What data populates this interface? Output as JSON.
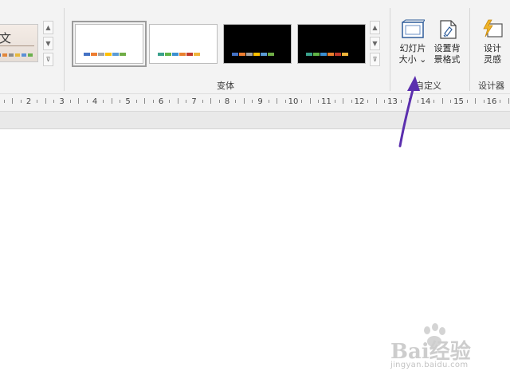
{
  "ribbon": {
    "themes": {
      "partial_glyph": "文",
      "partial_colors": [
        "#4a73b8",
        "#e2863a",
        "#8c8c8c",
        "#e6b83b",
        "#5b8fd6",
        "#6ab04c"
      ]
    },
    "variants": {
      "group_label": "变体",
      "items": [
        {
          "name": "variant-white-1",
          "bg": "#ffffff",
          "swatches": [
            "#4472c4",
            "#ed7d31",
            "#a5a5a5",
            "#ffc000",
            "#5b9bd5",
            "#70ad47"
          ]
        },
        {
          "name": "variant-white-2",
          "bg": "#ffffff",
          "swatches": [
            "#3aa18c",
            "#5fb346",
            "#3b8fd0",
            "#e8802e",
            "#c0392b",
            "#f0b53a"
          ]
        },
        {
          "name": "variant-black-1",
          "bg": "#000000",
          "swatches": [
            "#4472c4",
            "#ed7d31",
            "#a5a5a5",
            "#ffc000",
            "#5b9bd5",
            "#70ad47"
          ]
        },
        {
          "name": "variant-black-2",
          "bg": "#000000",
          "swatches": [
            "#3aa18c",
            "#5fb346",
            "#3b8fd0",
            "#e8802e",
            "#c0392b",
            "#f0b53a"
          ]
        }
      ]
    },
    "customize": {
      "group_label": "自定义",
      "slide_size": {
        "line1": "幻灯片",
        "line2": "大小",
        "chevron": "⌄"
      },
      "format_background": {
        "line1": "设置背",
        "line2": "景格式"
      }
    },
    "designer": {
      "group_label": "设计器",
      "design_ideas": {
        "line1": "设计",
        "line2": "灵感"
      }
    }
  },
  "ruler": {
    "numbers": [
      "2",
      "3",
      "4",
      "5",
      "6",
      "7",
      "8",
      "9",
      "10",
      "11",
      "12",
      "13",
      "14",
      "15",
      "16"
    ]
  },
  "annotation": {
    "arrow_color": "#5b2fae"
  },
  "watermark": {
    "brand": "Bai经验",
    "url": "jingyan.baidu.com"
  }
}
